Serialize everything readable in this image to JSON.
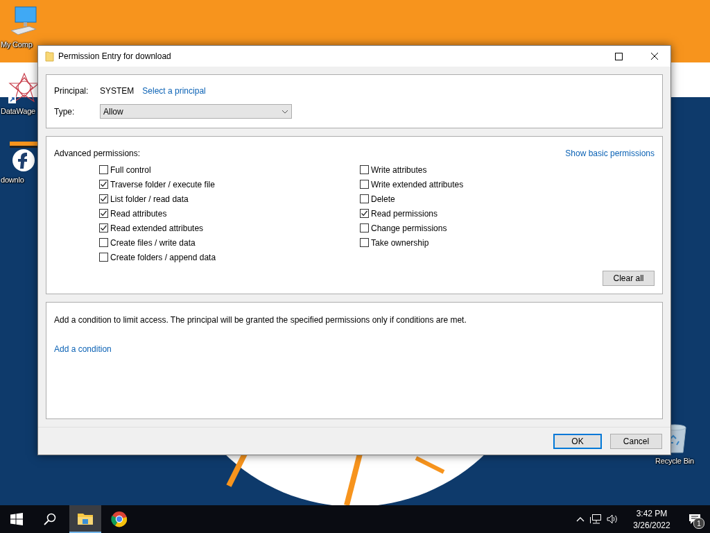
{
  "desktop_icons": [
    {
      "label": "My Comp",
      "kind": "computer"
    },
    {
      "label": "DataWage",
      "kind": "shortcut"
    },
    {
      "label": "downlo",
      "kind": "document"
    },
    {
      "label": "Recycle Bin",
      "kind": "recycle"
    }
  ],
  "window": {
    "title": "Permission Entry for download",
    "principal_label": "Principal:",
    "principal": "SYSTEM",
    "select_principal": "Select a principal",
    "type_label": "Type:",
    "type_value": "Allow",
    "advanced_label": "Advanced permissions:",
    "show_basic": "Show basic permissions",
    "permissions_left": [
      {
        "label": "Full control",
        "checked": false
      },
      {
        "label": "Traverse folder / execute file",
        "checked": true
      },
      {
        "label": "List folder / read data",
        "checked": true
      },
      {
        "label": "Read attributes",
        "checked": true
      },
      {
        "label": "Read extended attributes",
        "checked": true
      },
      {
        "label": "Create files / write data",
        "checked": false
      },
      {
        "label": "Create folders / append data",
        "checked": false
      }
    ],
    "permissions_right": [
      {
        "label": "Write attributes",
        "checked": false
      },
      {
        "label": "Write extended attributes",
        "checked": false
      },
      {
        "label": "Delete",
        "checked": false
      },
      {
        "label": "Read permissions",
        "checked": true
      },
      {
        "label": "Change permissions",
        "checked": false
      },
      {
        "label": "Take ownership",
        "checked": false
      }
    ],
    "clear_all": "Clear all",
    "condition_text": "Add a condition to limit access. The principal will be granted the specified permissions only if conditions are met.",
    "add_condition": "Add a condition",
    "buttons": [
      {
        "label": "OK",
        "default": true
      },
      {
        "label": "Cancel",
        "default": false
      }
    ]
  },
  "taskbar": {
    "apps": [
      {
        "kind": "explorer",
        "selected": true
      },
      {
        "kind": "chrome",
        "selected": false
      }
    ],
    "time": "3:42 PM",
    "date": "3/26/2022",
    "notification_count": "1"
  }
}
